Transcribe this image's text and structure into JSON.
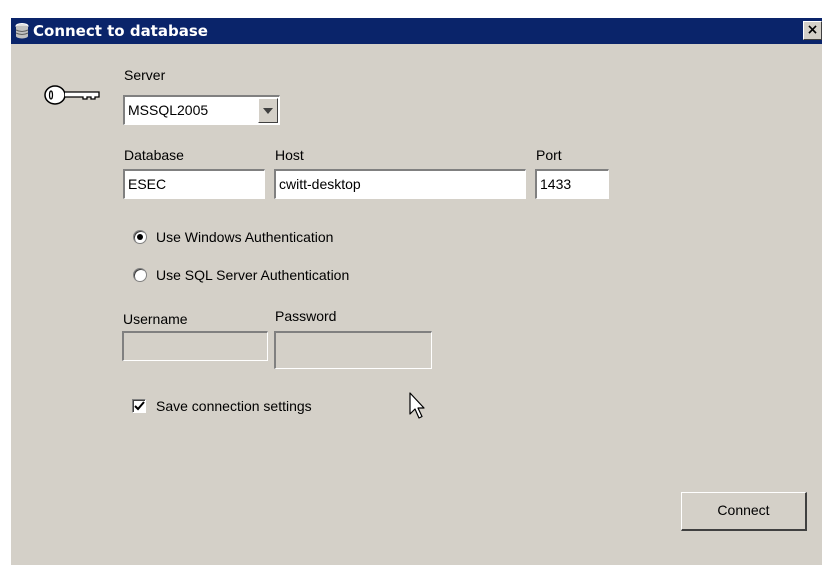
{
  "window": {
    "title": "Connect to database",
    "close_label": "×",
    "icon": "database-icon"
  },
  "server": {
    "label": "Server",
    "selected": "MSSQL2005",
    "icon": "key-icon"
  },
  "database": {
    "label": "Database",
    "value": "ESEC"
  },
  "host": {
    "label": "Host",
    "value": "cwitt-desktop"
  },
  "port": {
    "label": "Port",
    "value": "1433"
  },
  "auth": {
    "windows_label": "Use Windows Authentication",
    "sql_label": "Use SQL Server Authentication",
    "selected": "windows"
  },
  "username": {
    "label": "Username",
    "value": ""
  },
  "password": {
    "label": "Password",
    "value": ""
  },
  "save_settings": {
    "label": "Save connection settings",
    "checked": true
  },
  "connect_button": {
    "label": "Connect"
  }
}
